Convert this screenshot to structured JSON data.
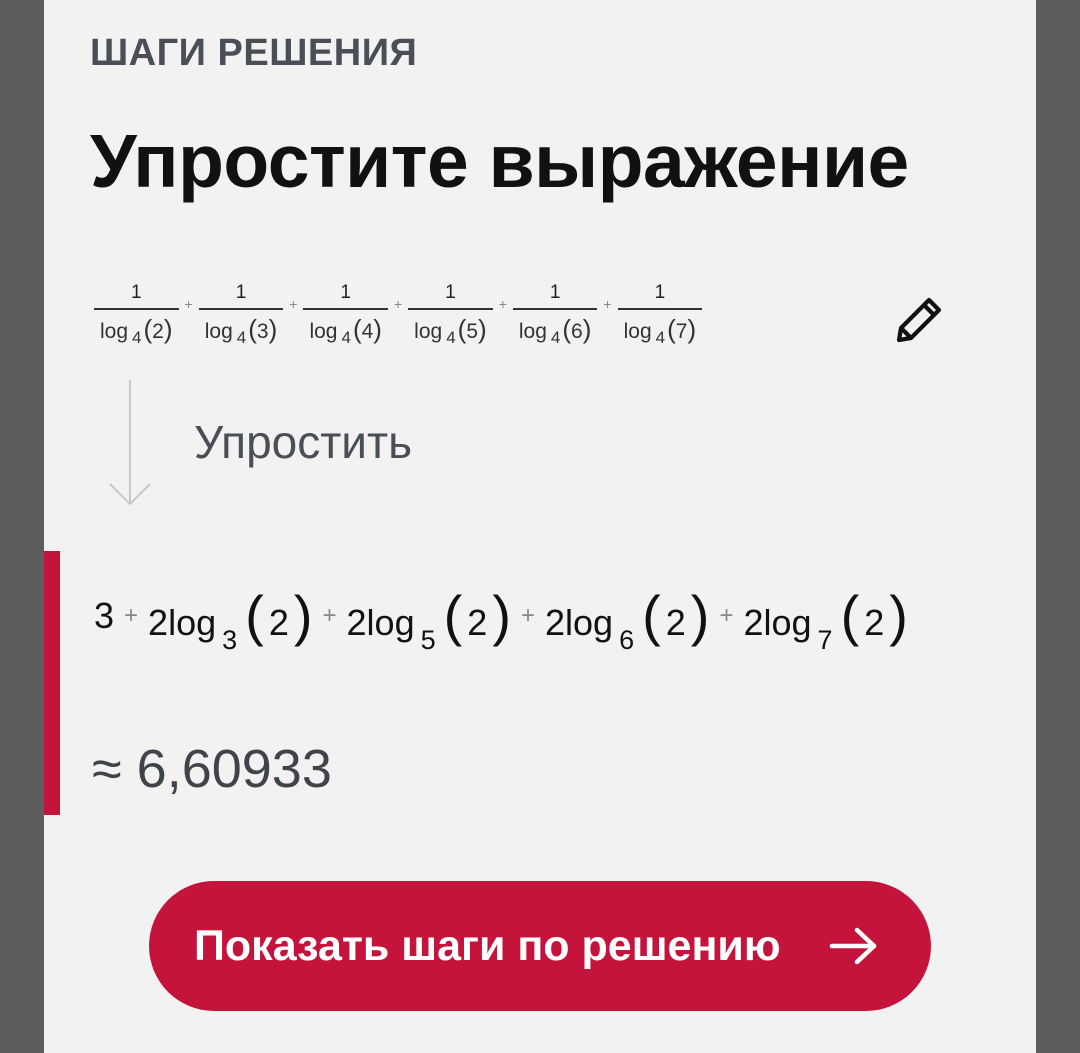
{
  "header": {
    "section_label": "ШАГИ РЕШЕНИЯ",
    "title": "Упростите выражение"
  },
  "input_expression": {
    "terms": [
      {
        "numerator": "1",
        "func": "log",
        "base": "4",
        "arg": "2"
      },
      {
        "numerator": "1",
        "func": "log",
        "base": "4",
        "arg": "3"
      },
      {
        "numerator": "1",
        "func": "log",
        "base": "4",
        "arg": "4"
      },
      {
        "numerator": "1",
        "func": "log",
        "base": "4",
        "arg": "5"
      },
      {
        "numerator": "1",
        "func": "log",
        "base": "4",
        "arg": "6"
      },
      {
        "numerator": "1",
        "func": "log",
        "base": "4",
        "arg": "7"
      }
    ],
    "operator": "+",
    "edit_icon": "pencil-icon"
  },
  "step": {
    "label": "Упростить",
    "arrow_icon": "arrow-down-icon"
  },
  "result": {
    "lead": "3",
    "operator": "+",
    "terms": [
      {
        "coef": "2",
        "func": "log",
        "base": "3",
        "arg": "2"
      },
      {
        "coef": "2",
        "func": "log",
        "base": "5",
        "arg": "2"
      },
      {
        "coef": "2",
        "func": "log",
        "base": "6",
        "arg": "2"
      },
      {
        "coef": "2",
        "func": "log",
        "base": "7",
        "arg": "2"
      }
    ],
    "approx_symbol": "≈",
    "approx_value": "6,60933"
  },
  "cta": {
    "label": "Показать шаги по решению",
    "icon": "arrow-right-icon"
  },
  "colors": {
    "accent": "#c4143c",
    "background": "#5d5d5d",
    "card": "#f2f2f2"
  }
}
